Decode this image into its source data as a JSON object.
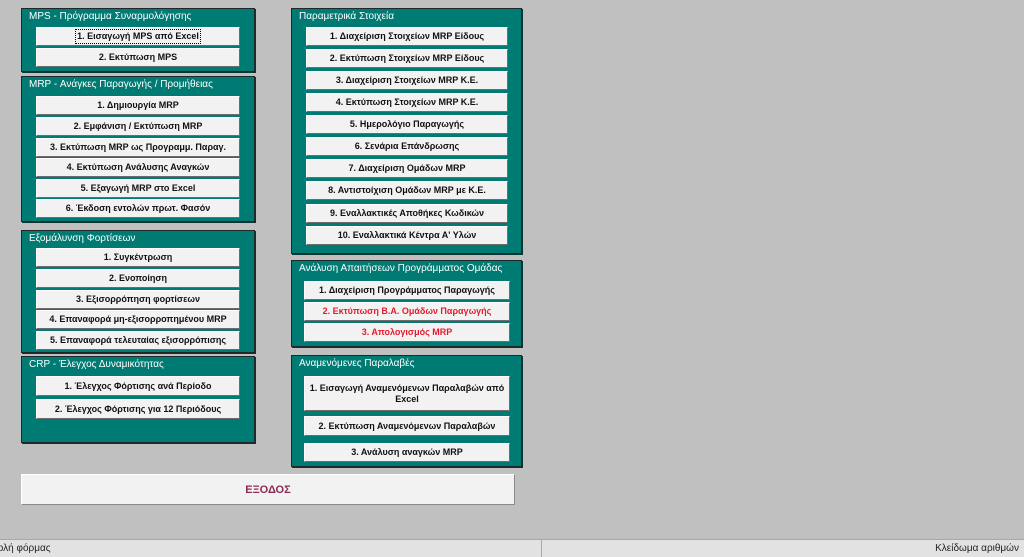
{
  "mps": {
    "title": "MPS - Πρόγραμμα Συναρμολόγησης",
    "buttons": [
      "1. Εισαγωγή MPS από Excel",
      "2. Εκτύπωση MPS"
    ]
  },
  "mrp": {
    "title": "MRP - Ανάγκες Παραγωγής / Προμήθειας",
    "buttons": [
      "1. Δημιουργία MRP",
      "2. Εμφάνιση / Εκτύπωση MRP",
      "3. Εκτύπωση MRP ως Προγραμμ. Παραγ.",
      "4. Εκτύπωση Ανάλυσης Αναγκών",
      "5. Εξαγωγή MRP στο Excel",
      "6. Έκδοση εντολών πρωτ. Φασόν"
    ]
  },
  "smoothing": {
    "title": "Εξομάλυνση Φορτίσεων",
    "buttons": [
      "1. Συγκέντρωση",
      "2. Ενοποίηση",
      "3. Εξισορρόπηση φορτίσεων",
      "4. Επαναφορά μη-εξισορροπημένου MRP",
      "5. Επαναφορά τελευταίας εξισορρόπισης"
    ]
  },
  "crp": {
    "title": "CRP - Έλεγχος Δυναμικότητας",
    "buttons": [
      "1. Έλεγχος Φόρτισης ανά Περίοδο",
      "2. Έλεγχος Φόρτισης για 12 Περιόδους"
    ]
  },
  "params": {
    "title": "Παραμετρικά Στοιχεία",
    "buttons": [
      "1. Διαχείριση Στοιχείων MRP Είδους",
      "2. Εκτύπωση Στοιχείων MRP Είδους",
      "3. Διαχείριση Στοιχείων MRP Κ.Ε.",
      "4. Εκτύπωση Στοιχείων MRP Κ.Ε.",
      "5. Ημερολόγιο Παραγωγής",
      "6. Σενάρια Επάνδρωσης",
      "7. Διαχείριση Ομάδων MRP",
      "8. Αντιστοίχιση Ομάδων MRP με Κ.Ε.",
      "9. Εναλλακτικές Αποθήκες Κωδικών",
      "10. Εναλλακτικά Κέντρα Α' Υλών"
    ]
  },
  "group_analysis": {
    "title": "Ανάλυση Απαιτήσεων Προγράμματος Ομάδας",
    "buttons": [
      "1. Διαχείριση Προγράμματος Παραγωγής",
      "2. Εκτύπωση Β.Α. Ομάδων Παραγωγής",
      "3. Απολογισμός MRP"
    ]
  },
  "expected": {
    "title": "Αναμενόμενες Παραλαβές",
    "buttons": [
      "1. Εισαγωγή Αναμενόμενων Παραλαβών από Excel",
      "2. Εκτύπωση Αναμενόμενων Παραλαβών",
      "3. Ανάλυση αναγκών MRP"
    ]
  },
  "exit_label": "ΕΞΟΔΟΣ",
  "status": {
    "left": "βολή φόρμας",
    "right": "Κλείδωμα αριθμών"
  },
  "colors": {
    "panel": "#007b73",
    "background": "#c0c0c0",
    "highlight_text": "#e8192c",
    "exit_text": "#8d2a55"
  }
}
